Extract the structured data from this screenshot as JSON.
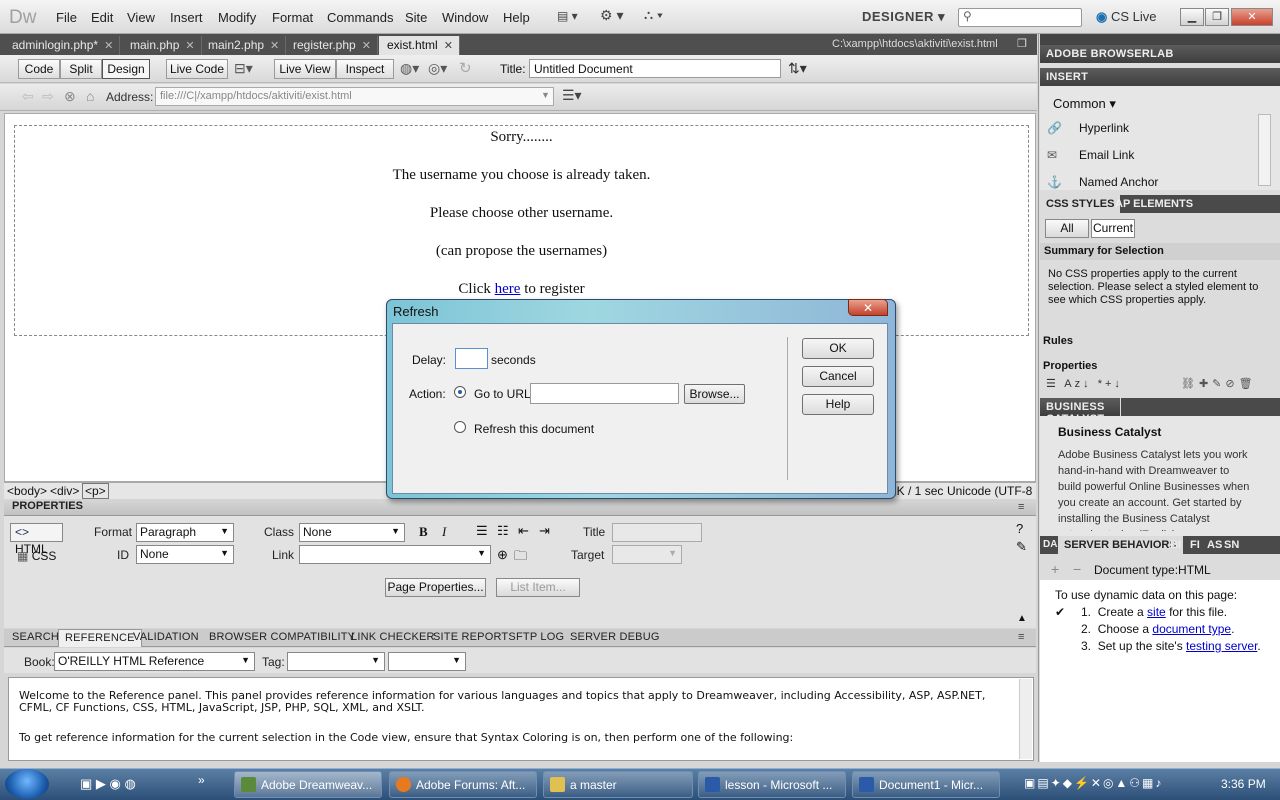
{
  "app": {
    "logo": "Dw",
    "menu": [
      "File",
      "Edit",
      "View",
      "Insert",
      "Modify",
      "Format",
      "Commands",
      "Site",
      "Window",
      "Help"
    ],
    "workspace": "DESIGNER",
    "cslive": "CS Live",
    "window_controls": [
      "minimize",
      "restore",
      "close"
    ]
  },
  "doc_tabs": {
    "tabs": [
      "adminlogin.php*",
      "main.php",
      "main2.php",
      "register.php",
      "exist.html"
    ],
    "active": "exist.html",
    "file_path": "C:\\xampp\\htdocs\\aktiviti\\exist.html"
  },
  "toolbar": {
    "view_buttons": [
      "Code",
      "Split",
      "Design"
    ],
    "active_view": "Design",
    "live_code": "Live Code",
    "live_view": "Live View",
    "inspect": "Inspect",
    "title_label": "Title:",
    "title_value": "Untitled Document",
    "address_label": "Address:",
    "address_value": "file:///C|/xampp/htdocs/aktiviti/exist.html"
  },
  "page": {
    "lines": [
      "Sorry........",
      "The username you choose is already taken.",
      "Please choose other username.",
      "(can propose the usernames)"
    ],
    "click_prefix": "Click ",
    "link_text": "here",
    "click_suffix": " to register"
  },
  "status": {
    "tags": [
      "<body>",
      "<div>",
      "<p>"
    ],
    "right": "1K / 1 sec",
    "encoding": "Unicode (UTF-8"
  },
  "properties": {
    "header": "PROPERTIES",
    "html_tab": "HTML",
    "css_tab": "CSS",
    "format_label": "Format",
    "format_value": "Paragraph",
    "class_label": "Class",
    "class_value": "None",
    "id_label": "ID",
    "id_value": "None",
    "link_label": "Link",
    "title_label": "Title",
    "target_label": "Target",
    "page_properties": "Page Properties...",
    "list_item": "List Item..."
  },
  "reference": {
    "tabs": [
      "SEARCH",
      "REFERENCE",
      "VALIDATION",
      "BROWSER COMPATIBILITY",
      "LINK CHECKER",
      "SITE REPORTS",
      "FTP LOG",
      "SERVER DEBUG"
    ],
    "active_tab": "REFERENCE",
    "book_label": "Book:",
    "book_value": "O'REILLY HTML Reference",
    "tag_label": "Tag:",
    "text1": "Welcome to the Reference panel. This panel provides reference information for various languages and topics that apply to Dreamweaver, including Accessibility, ASP, ASP.NET, CFML, CF Functions, CSS, HTML, JavaScript, JSP, PHP, SQL, XML, and XSLT.",
    "text2": "To get reference information for the current selection in the Code view, ensure that Syntax Coloring is on, then perform one of the following:"
  },
  "right_panels": {
    "browserlab": "ADOBE BROWSERLAB",
    "insert": "INSERT",
    "insert_category": "Common",
    "insert_items": [
      "Hyperlink",
      "Email Link",
      "Named Anchor"
    ],
    "css_styles_tab": "CSS STYLES",
    "ap_elements_tab": "AP ELEMENTS",
    "all_btn": "All",
    "current_btn": "Current",
    "summary_title": "Summary for Selection",
    "summary_text": "No CSS properties apply to the current selection.  Please select a styled element to see which CSS properties apply.",
    "rules": "Rules",
    "properties": "Properties",
    "business_catalyst_head": "BUSINESS CATALYST",
    "bc_title": "Business Catalyst",
    "bc_text": "Adobe Business Catalyst lets you work hand-in-hand with Dreamweaver to build powerful Online Businesses when you create an account. Get started by installing the Business Catalyst extension today (English",
    "db_tab": "DA",
    "server_behaviors_tab": "SERVER BEHAVIORS",
    "bi_tab": "BI",
    "fi_tab": "FI",
    "as_tab": "AS",
    "sn_tab": "SN",
    "doc_type": "Document type:HTML",
    "dynamic_intro": "To use dynamic data on this page:",
    "steps": [
      {
        "num": "1.",
        "pre": "Create a ",
        "link": "site",
        "post": " for this file."
      },
      {
        "num": "2.",
        "pre": "Choose a ",
        "link": "document type",
        "post": "."
      },
      {
        "num": "3.",
        "pre": "Set up the site's ",
        "link": "testing server",
        "post": "."
      }
    ]
  },
  "dialog": {
    "title": "Refresh",
    "delay_label": "Delay:",
    "delay_value": "",
    "seconds": "seconds",
    "action_label": "Action:",
    "goto_label": "Go to URL:",
    "goto_value": "",
    "browse": "Browse...",
    "refresh_label": "Refresh this document",
    "ok": "OK",
    "cancel": "Cancel",
    "help": "Help",
    "selected_action": "Go to URL"
  },
  "taskbar": {
    "tasks": [
      "Adobe Dreamweav...",
      "Adobe Forums: Aft...",
      "a master",
      "lesson - Microsoft ...",
      "Document1 - Micr..."
    ],
    "active": "Adobe Dreamweav...",
    "overflow": "»",
    "clock": "3:36 PM"
  }
}
